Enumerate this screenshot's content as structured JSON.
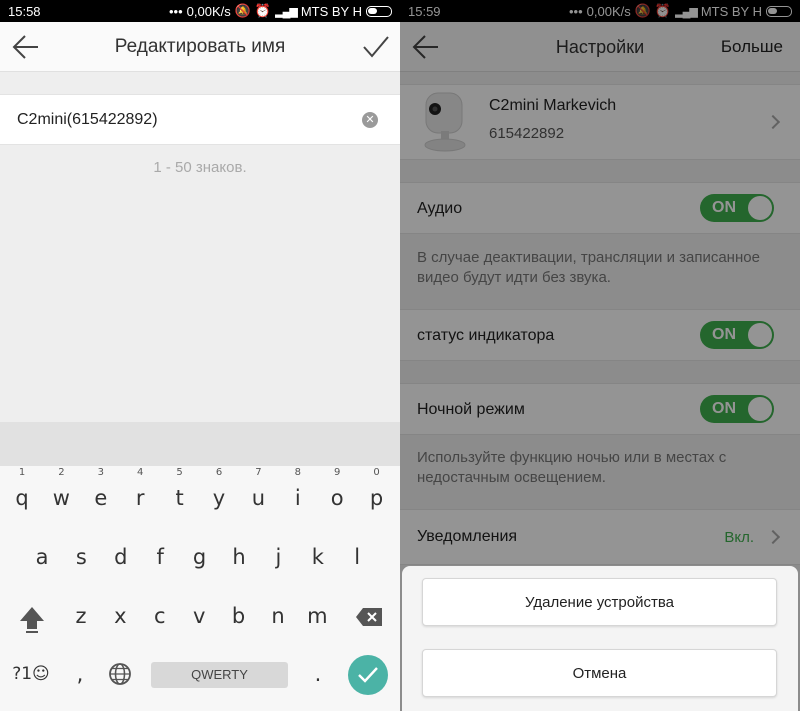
{
  "left": {
    "status": {
      "time": "15:58",
      "speed": "0,00K/s",
      "carrier": "MTS BY H"
    },
    "header": {
      "title": "Редактировать имя"
    },
    "name_field": {
      "value": "C2mini(615422892)"
    },
    "hint": "1 - 50 знаков.",
    "keyboard": {
      "row1": [
        {
          "k": "q",
          "n": "1"
        },
        {
          "k": "w",
          "n": "2"
        },
        {
          "k": "e",
          "n": "3"
        },
        {
          "k": "r",
          "n": "4"
        },
        {
          "k": "t",
          "n": "5"
        },
        {
          "k": "y",
          "n": "6"
        },
        {
          "k": "u",
          "n": "7"
        },
        {
          "k": "i",
          "n": "8"
        },
        {
          "k": "o",
          "n": "9"
        },
        {
          "k": "p",
          "n": "0"
        }
      ],
      "row2": [
        "a",
        "s",
        "d",
        "f",
        "g",
        "h",
        "j",
        "k",
        "l"
      ],
      "row3": [
        "z",
        "x",
        "c",
        "v",
        "b",
        "n",
        "m"
      ],
      "symbols_label": "?1☺",
      "comma": ",",
      "space_label": "QWERTY",
      "period": "."
    }
  },
  "right": {
    "status": {
      "time": "15:59",
      "speed": "0,00K/s",
      "carrier": "MTS BY H"
    },
    "header": {
      "title": "Настройки",
      "more": "Больше"
    },
    "device": {
      "name": "C2mini Markevich",
      "id": "615422892"
    },
    "audio": {
      "label": "Аудио",
      "toggle": "ON",
      "desc": "В случае деактивации, трансляции и записанное видео будут идти без звука."
    },
    "indicator": {
      "label": "статус индикатора",
      "toggle": "ON"
    },
    "night": {
      "label": "Ночной режим",
      "toggle": "ON",
      "desc": "Используйте функцию ночью или в местах с недостачным освещением."
    },
    "notifications": {
      "label": "Уведомления",
      "value": "Вкл."
    },
    "sheet": {
      "delete": "Удаление устройства",
      "cancel": "Отмена"
    }
  },
  "colors": {
    "toggle_on": "#3fb04e",
    "enter_key": "#4bb3a6"
  }
}
